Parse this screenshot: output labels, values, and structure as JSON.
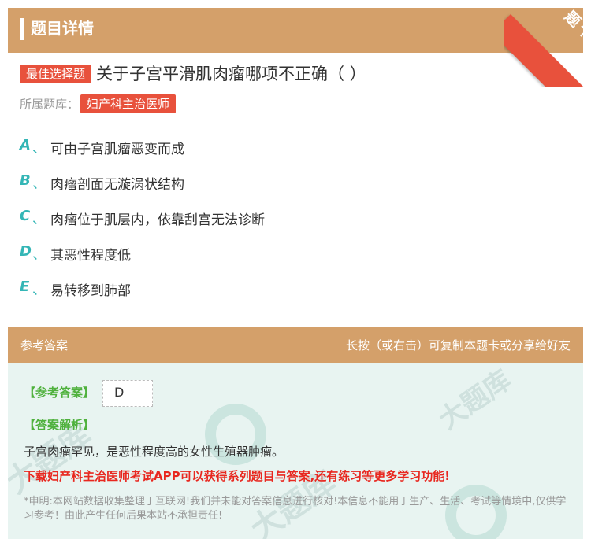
{
  "header": {
    "title": "题目详情",
    "corner_label": "题卡"
  },
  "question": {
    "type_tag": "最佳选择题",
    "text": "关于子宫平滑肌肉瘤哪项不正确（ ）",
    "bank_label": "所属题库：",
    "bank_name": "妇产科主治医师"
  },
  "options": [
    {
      "letter": "A",
      "sep": "、",
      "text": "可由子宫肌瘤恶变而成"
    },
    {
      "letter": "B",
      "sep": "、",
      "text": "肉瘤剖面无漩涡状结构"
    },
    {
      "letter": "C",
      "sep": "、",
      "text": "肉瘤位于肌层内，依靠刮宫无法诊断"
    },
    {
      "letter": "D",
      "sep": "、",
      "text": "其恶性程度低"
    },
    {
      "letter": "E",
      "sep": "、",
      "text": "易转移到肺部"
    }
  ],
  "answer_section": {
    "title": "参考答案",
    "hint": "长按（或右击）可复制本题卡或分享给好友",
    "answer_label": "【参考答案】",
    "answer_value": "D",
    "analysis_label": "【答案解析】",
    "analysis_text": "子宫肉瘤罕见，是恶性程度高的女性生殖器肿瘤。",
    "promo_text": "下载妇产科主治医师考试APP可以获得系列题目与答案,还有练习等更多学习功能!",
    "disclaimer": "*申明:本网站数据收集整理于互联网!我们并未能对答案信息进行核对!本信息不能用于生产、生活、考试等情境中,仅供学习参考！由此产生任何后果本站不承担责任!"
  },
  "colors": {
    "header_bg": "#d4a06a",
    "tag_red": "#e8513c",
    "option_letter": "#34b6b6",
    "answer_label": "#4fb13d",
    "promo": "#e8271f",
    "answer_bg": "#e8f4f1"
  }
}
